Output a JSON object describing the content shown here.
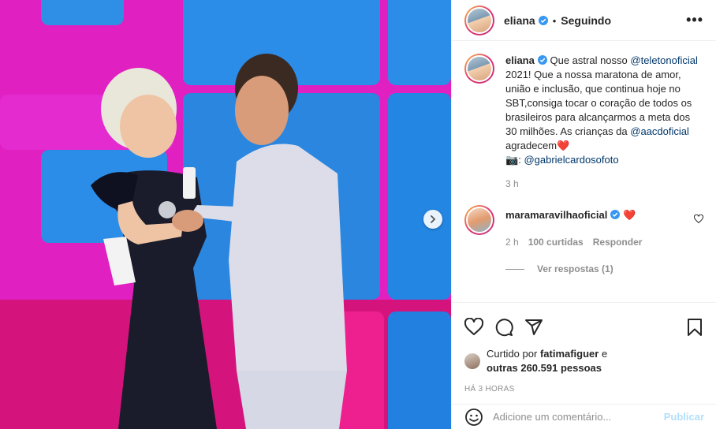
{
  "post": {
    "username": "eliana",
    "follow_state": "Seguindo",
    "more_label": "•••",
    "caption": {
      "text_1": "Que astral nosso",
      "mention_1": "@teletonoficial",
      "text_2": "2021! Que a nossa maratona de amor, união e inclusão, que continua hoje no SBT,consiga tocar o coração de todos os brasileiros para alcançarmos a meta dos 30 milhões. As crianças da",
      "mention_2": "@aacdoficial",
      "text_3": "agradecem",
      "emoji_heart": "❤️",
      "emoji_camera": "📷",
      "text_4": ":",
      "mention_3": "@gabrielcardosofoto"
    },
    "caption_time": "3 h"
  },
  "comment": {
    "username": "maramaravilhaoficial",
    "emoji_heart": "❤️",
    "time": "2 h",
    "likes": "100 curtidas",
    "reply_label": "Responder",
    "view_replies": "Ver respostas (1)"
  },
  "likes": {
    "prefix": "Curtido por",
    "user": "fatimafiguer",
    "connector": "e",
    "others": "outras 260.591 pessoas"
  },
  "timestamp": "HÁ 3 HORAS",
  "add_comment": {
    "placeholder": "Adicione um comentário...",
    "publish_label": "Publicar"
  },
  "colors": {
    "verified": "#3897f0",
    "link": "#00376b",
    "muted": "#8e8e8e",
    "heart": "#ed4956",
    "publish_disabled": "#b2dffc"
  },
  "icons": {
    "media_next": "chevron-right-icon",
    "like": "heart-icon",
    "comment": "comment-bubble-icon",
    "share": "paper-plane-icon",
    "save": "bookmark-icon",
    "emoji": "smiley-icon"
  }
}
